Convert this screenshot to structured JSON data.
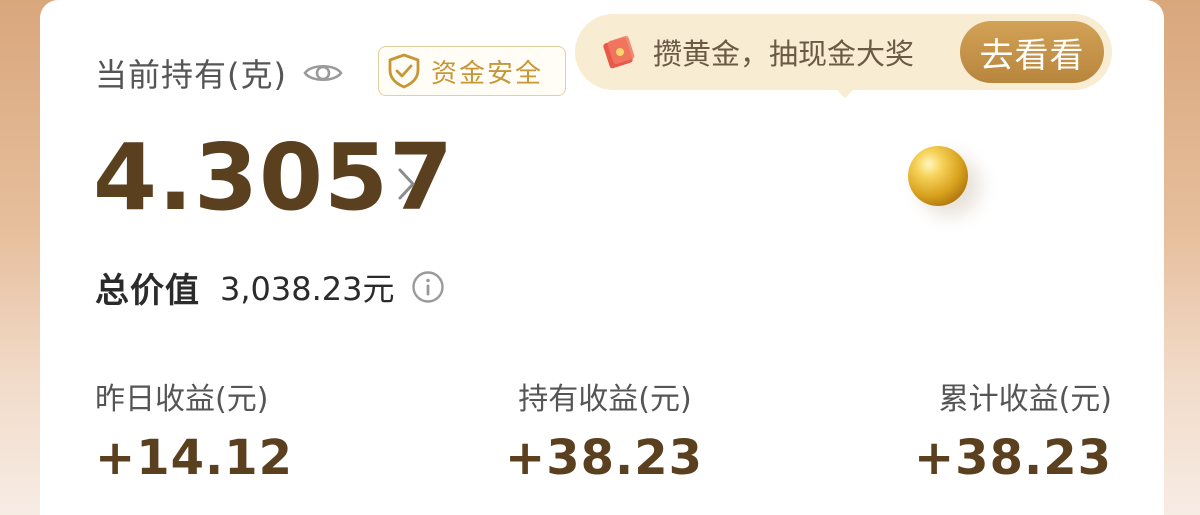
{
  "holding": {
    "label": "当前持有(克)",
    "grams": "4.3057",
    "badge_text": "资金安全"
  },
  "promo": {
    "text": "攒黄金，抽现金大奖",
    "button_label": "去看看"
  },
  "total": {
    "label": "总价值",
    "value": "3,038.23元"
  },
  "stats": [
    {
      "label": "昨日收益(元)",
      "value": "+14.12"
    },
    {
      "label": "持有收益(元)",
      "value": "+38.23"
    },
    {
      "label": "累计收益(元)",
      "value": "+38.23"
    }
  ],
  "icons": {
    "eye": "eye-icon",
    "shield": "shield-check-icon",
    "gift": "red-envelope-icon",
    "chevron": "chevron-right-icon",
    "info": "info-icon",
    "gold": "gold-bead-icon"
  },
  "colors": {
    "accent_brown": "#5b4020",
    "gold": "#c79637",
    "promo_bg": "#f8ecd2",
    "button_gold": "#c39147"
  }
}
